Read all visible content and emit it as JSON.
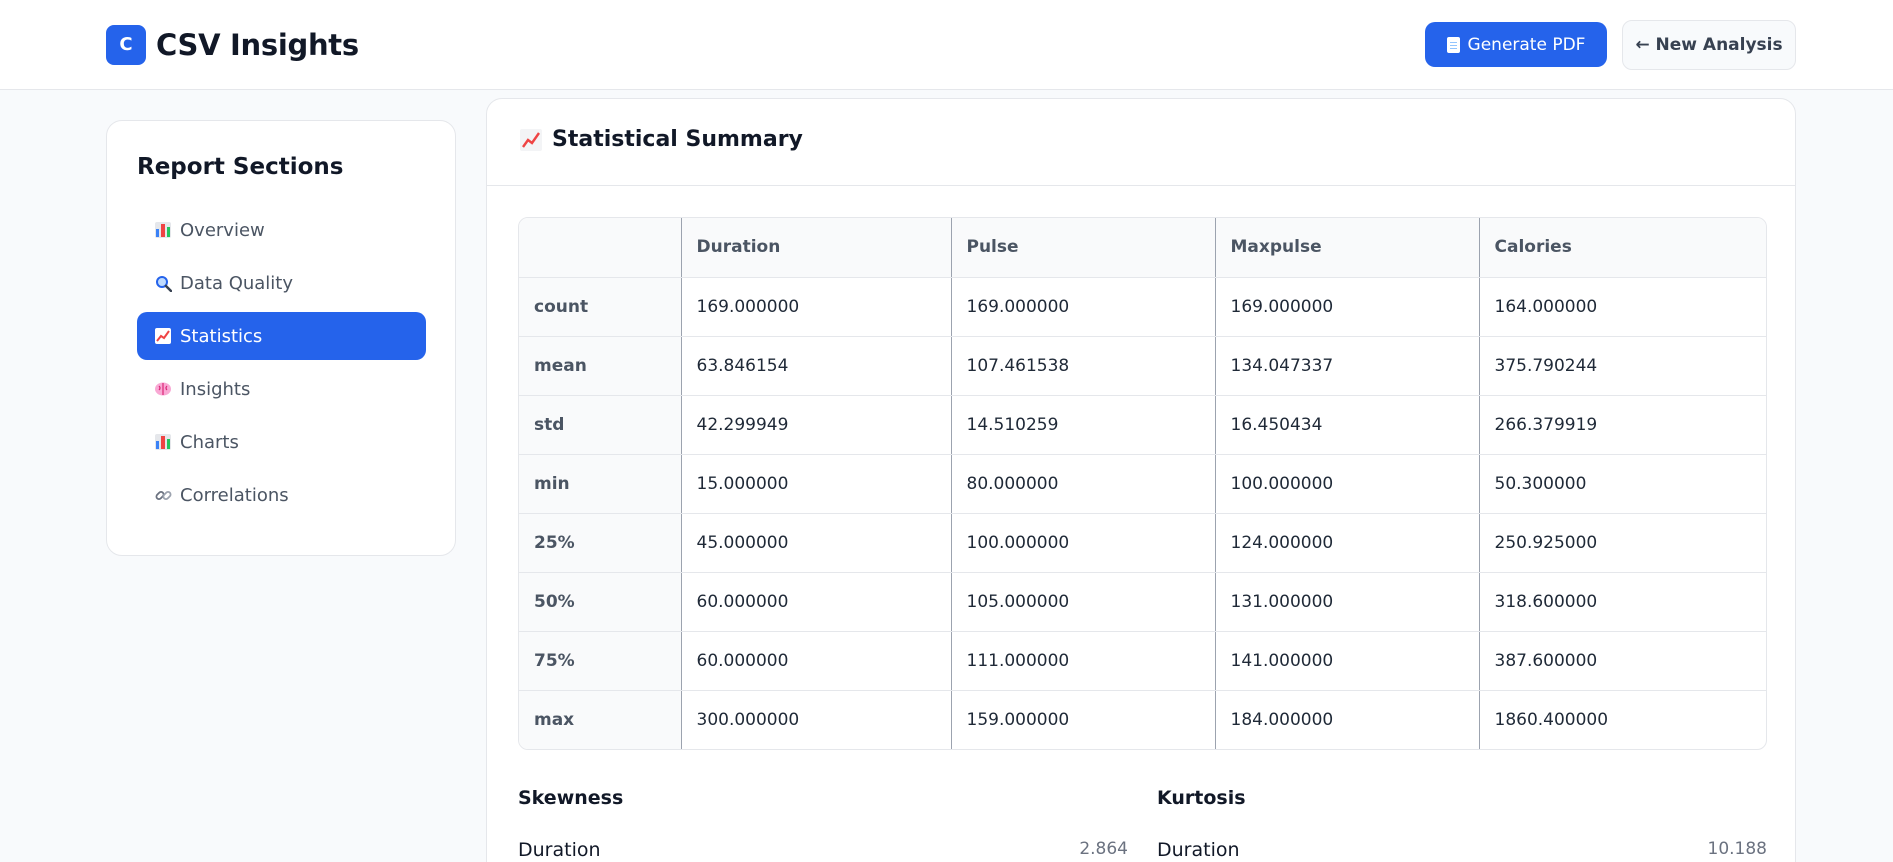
{
  "header": {
    "logo_letter": "C",
    "app_title": "CSV Insights",
    "pdf_button": "Generate PDF",
    "new_analysis_button": "← New Analysis"
  },
  "sidebar": {
    "title": "Report Sections",
    "items": [
      {
        "label": "Overview",
        "icon": "bar-chart-icon",
        "active": false
      },
      {
        "label": "Data Quality",
        "icon": "magnifier-icon",
        "active": false
      },
      {
        "label": "Statistics",
        "icon": "trend-chart-icon",
        "active": true
      },
      {
        "label": "Insights",
        "icon": "brain-icon",
        "active": false
      },
      {
        "label": "Charts",
        "icon": "bar-chart-icon",
        "active": false
      },
      {
        "label": "Correlations",
        "icon": "link-icon",
        "active": false
      }
    ]
  },
  "main": {
    "title": "Statistical Summary",
    "table": {
      "columns": [
        "",
        "Duration",
        "Pulse",
        "Maxpulse",
        "Calories"
      ],
      "rows": [
        {
          "label": "count",
          "values": [
            "169.000000",
            "169.000000",
            "169.000000",
            "164.000000"
          ]
        },
        {
          "label": "mean",
          "values": [
            "63.846154",
            "107.461538",
            "134.047337",
            "375.790244"
          ]
        },
        {
          "label": "std",
          "values": [
            "42.299949",
            "14.510259",
            "16.450434",
            "266.379919"
          ]
        },
        {
          "label": "min",
          "values": [
            "15.000000",
            "80.000000",
            "100.000000",
            "50.300000"
          ]
        },
        {
          "label": "25%",
          "values": [
            "45.000000",
            "100.000000",
            "124.000000",
            "250.925000"
          ]
        },
        {
          "label": "50%",
          "values": [
            "60.000000",
            "105.000000",
            "131.000000",
            "318.600000"
          ]
        },
        {
          "label": "75%",
          "values": [
            "60.000000",
            "111.000000",
            "141.000000",
            "387.600000"
          ]
        },
        {
          "label": "max",
          "values": [
            "300.000000",
            "159.000000",
            "184.000000",
            "1860.400000"
          ]
        }
      ]
    },
    "skewness": {
      "title": "Skewness",
      "rows": [
        {
          "name": "Duration",
          "value": "2.864"
        }
      ]
    },
    "kurtosis": {
      "title": "Kurtosis",
      "rows": [
        {
          "name": "Duration",
          "value": "10.188"
        }
      ]
    }
  },
  "colors": {
    "accent": "#2563eb",
    "background": "#f8fafc",
    "border": "#e5e7eb"
  }
}
